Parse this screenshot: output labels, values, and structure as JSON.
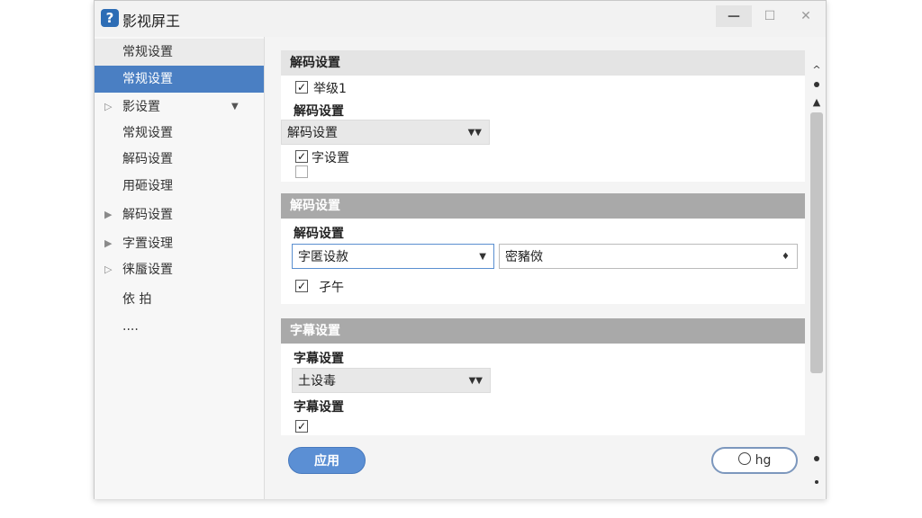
{
  "window": {
    "title": "影视屏王",
    "logo_glyph": "?",
    "controls": {
      "minimize": "—",
      "maximize": "☐",
      "close": "✕"
    }
  },
  "sidebar": {
    "items": [
      {
        "label": "常规设置",
        "arrow": "",
        "dropdown": ""
      },
      {
        "label": "常规设置",
        "arrow": "",
        "dropdown": ""
      },
      {
        "label": "影设置",
        "arrow": "▷",
        "dropdown": "▼"
      },
      {
        "label": "常规设置",
        "arrow": "",
        "dropdown": ""
      },
      {
        "label": "解码设置",
        "arrow": "",
        "dropdown": ""
      },
      {
        "label": "用砸设理",
        "arrow": "",
        "dropdown": ""
      },
      {
        "label": "解码设置",
        "arrow": "▶",
        "dropdown": ""
      },
      {
        "label": "字置设理",
        "arrow": "▶",
        "dropdown": ""
      },
      {
        "label": "徕蜃设置",
        "arrow": "▷",
        "dropdown": ""
      },
      {
        "label": "依  拍",
        "arrow": "",
        "dropdown": ""
      },
      {
        "label": "....",
        "arrow": "",
        "dropdown": ""
      }
    ]
  },
  "section1": {
    "header": "解码设置",
    "checkbox1_label": "举级1",
    "field_label": "解码设置",
    "combo_value": "解码设置",
    "combo_arrow": "▼▼",
    "checkbox2_label": "字设置"
  },
  "section2": {
    "header": "解码设置",
    "field_label": "解码设置",
    "combo1_value": "字匿设赦",
    "combo1_arrow": "▼",
    "combo2_value": "密豬傚",
    "combo2_arrow": "♦",
    "checkbox_label": "孑午"
  },
  "section3": {
    "header": "字幕设置",
    "field_label": "字幕设置",
    "combo_value": "土设毒",
    "combo_arrow": "▼▼",
    "second_label": "字幕设置"
  },
  "footer": {
    "apply_label": "应用",
    "hg_label": "hg"
  },
  "scrollbar": {
    "up": "^",
    "up2": "▲"
  },
  "checkmark": "✓"
}
